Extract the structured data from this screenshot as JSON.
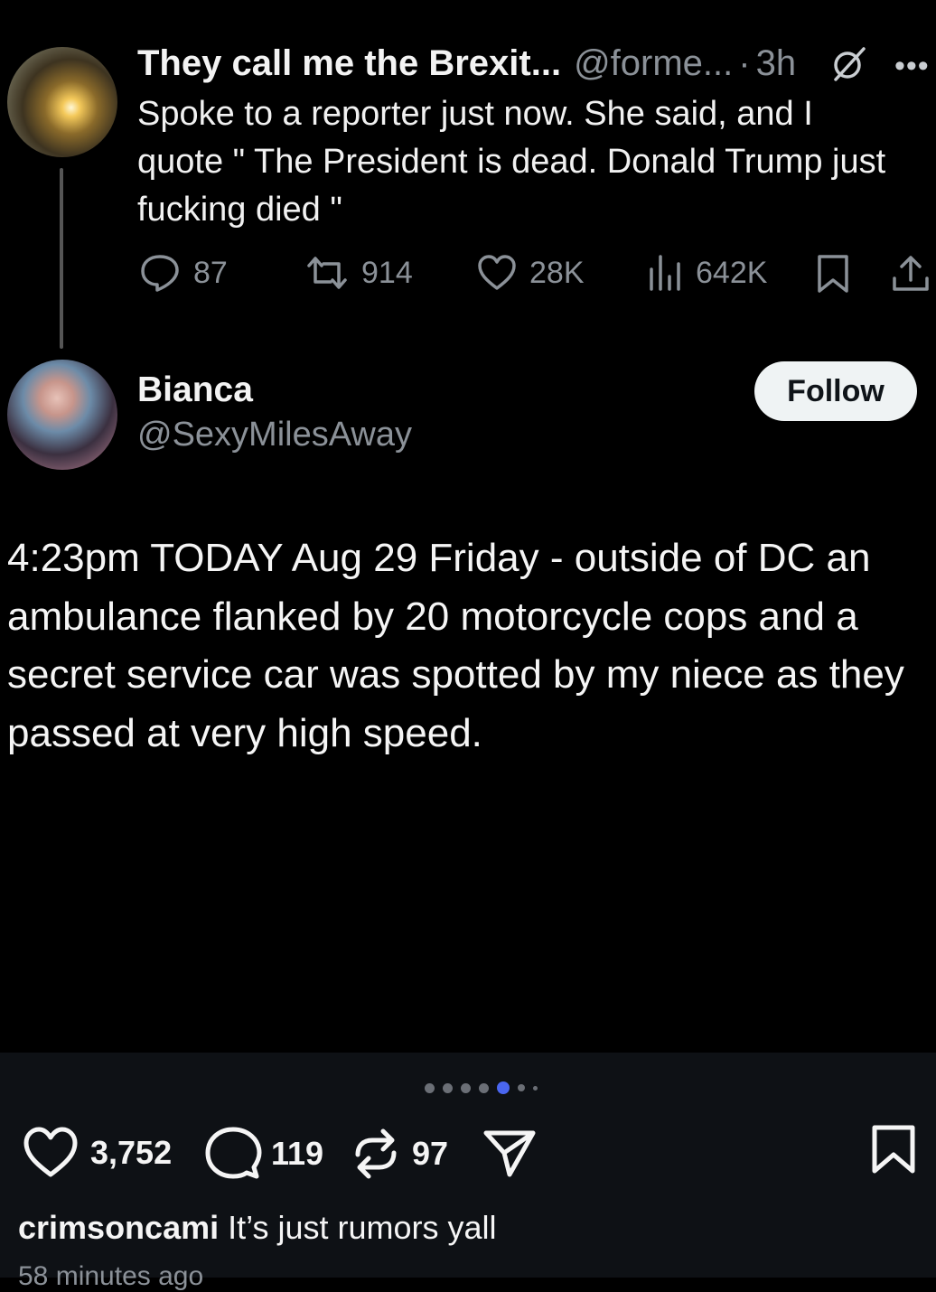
{
  "tweet": {
    "display_name": "They call me the Brexit...",
    "handle": "@forme...",
    "separator": "·",
    "time": "3h",
    "text": "Spoke to a reporter just now. She said, and I quote \" The President is dead. Donald Trump just fucking died \"",
    "actions": {
      "replies": "87",
      "retweets": "914",
      "likes": "28K",
      "views": "642K"
    }
  },
  "quoted_account": {
    "display_name": "Bianca",
    "handle": "@SexyMilesAway",
    "follow_label": "Follow",
    "post_text": "4:23pm TODAY Aug 29 Friday - outside of DC an ambulance flanked by 20 motorcycle cops and a secret service car was spotted by my niece as they passed at very high speed."
  },
  "carousel": {
    "active_index": 4,
    "active_color": "#4a66f0"
  },
  "instagram": {
    "likes": "3,752",
    "comments": "119",
    "reposts": "97",
    "caption_user": "crimsoncami",
    "caption_text": "It’s just rumors yall",
    "timestamp": "58 minutes ago"
  },
  "colors": {
    "background": "#000000",
    "text_primary": "#e7e9ea",
    "text_muted": "#8b9198",
    "follow_button_bg": "#eff3f4"
  }
}
